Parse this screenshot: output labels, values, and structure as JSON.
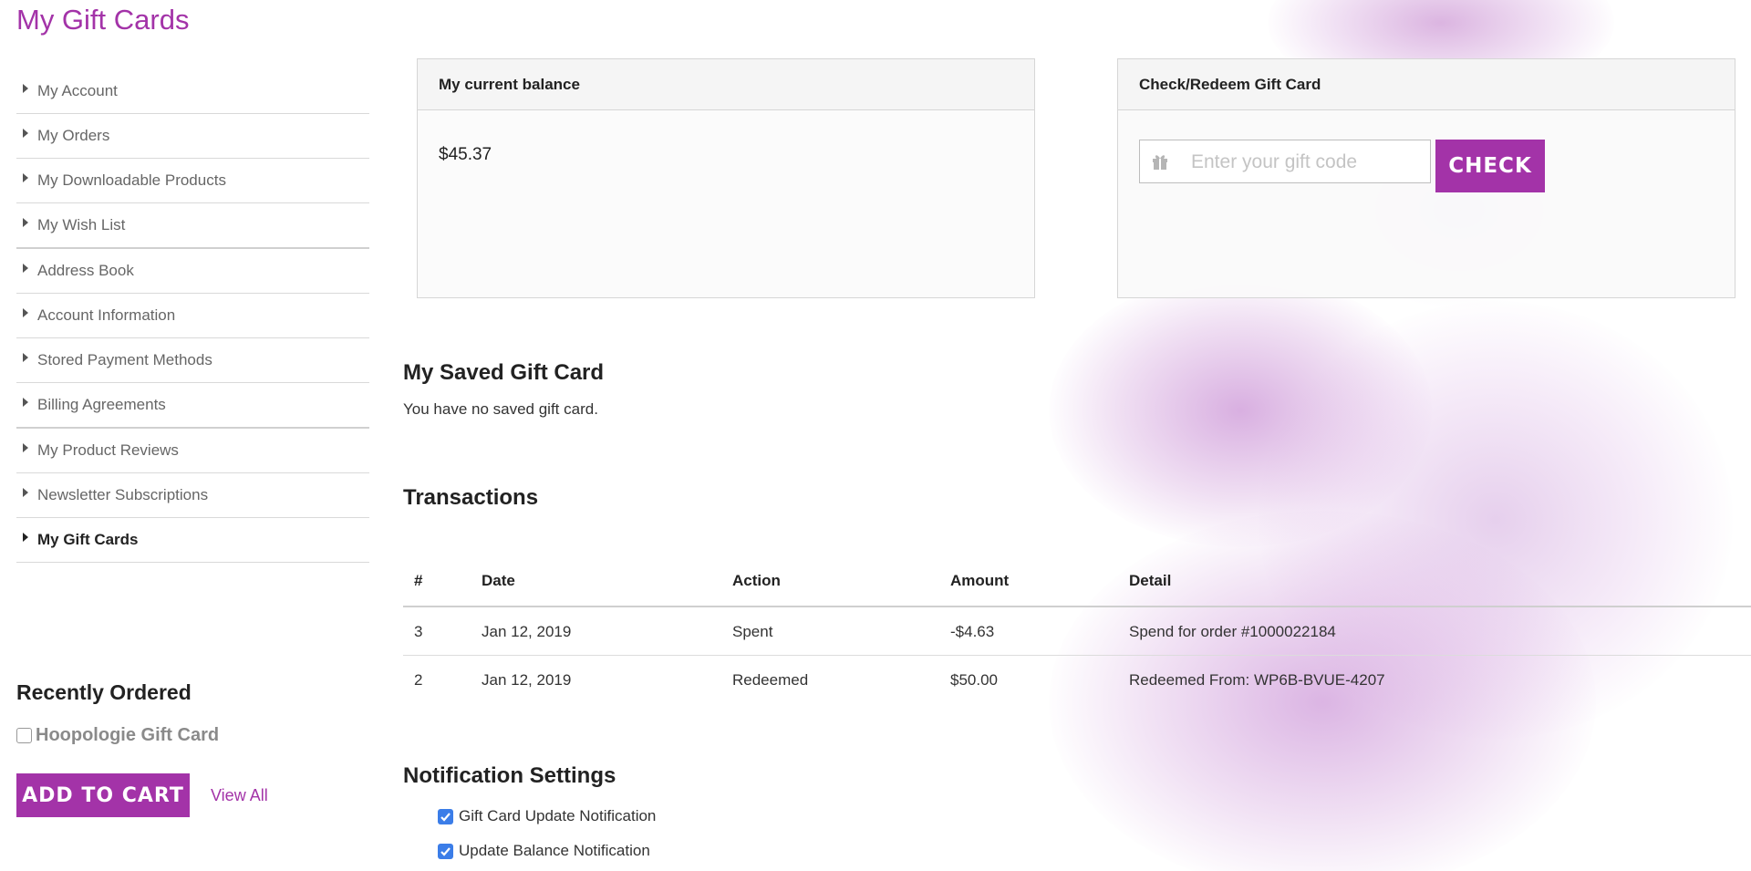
{
  "page": {
    "title": "My Gift Cards"
  },
  "colors": {
    "accent": "#a333a8",
    "checkbox": "#3b7de8"
  },
  "sidebar": {
    "items": [
      {
        "label": "My Account"
      },
      {
        "label": "My Orders"
      },
      {
        "label": "My Downloadable Products"
      },
      {
        "label": "My Wish List"
      },
      {
        "label": "Address Book"
      },
      {
        "label": "Account Information"
      },
      {
        "label": "Stored Payment Methods"
      },
      {
        "label": "Billing Agreements"
      },
      {
        "label": "My Product Reviews"
      },
      {
        "label": "Newsletter Subscriptions"
      },
      {
        "label": "My Gift Cards",
        "active": true
      }
    ]
  },
  "recent": {
    "title": "Recently Ordered",
    "item": "Hoopologie Gift Card",
    "add_to_cart": "ADD TO CART",
    "view_all": "View All"
  },
  "balance": {
    "title": "My current balance",
    "value": "$45.37"
  },
  "redeem": {
    "title": "Check/Redeem Gift Card",
    "placeholder": "Enter your gift code",
    "icon": "gift-icon",
    "button": "CHECK"
  },
  "saved": {
    "title": "My Saved Gift Card",
    "text": "You have no saved gift card."
  },
  "transactions": {
    "title": "Transactions",
    "columns": [
      "#",
      "Date",
      "Action",
      "Amount",
      "Detail"
    ],
    "rows": [
      [
        "3",
        "Jan 12, 2019",
        "Spent",
        "-$4.63",
        "Spend for order #1000022184"
      ],
      [
        "2",
        "Jan 12, 2019",
        "Redeemed",
        "$50.00",
        "Redeemed From: WP6B-BVUE-4207"
      ]
    ]
  },
  "notifications": {
    "title": "Notification Settings",
    "items": [
      {
        "label": "Gift Card Update Notification",
        "checked": true
      },
      {
        "label": "Update Balance Notification",
        "checked": true
      }
    ]
  }
}
